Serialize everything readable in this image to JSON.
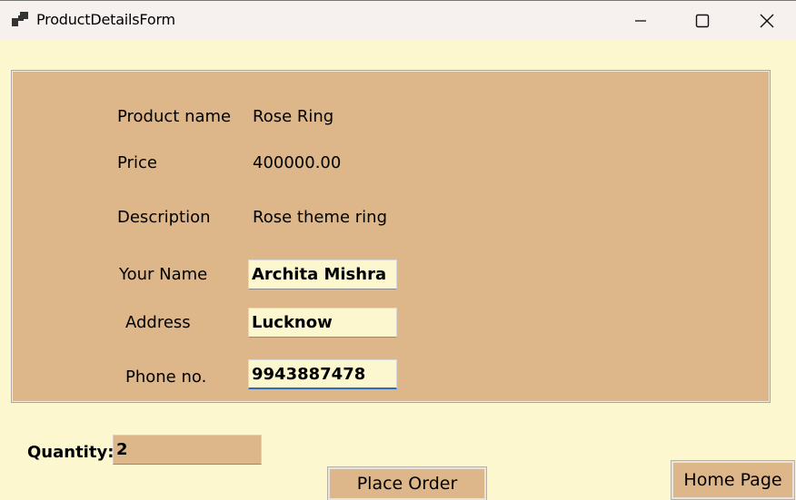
{
  "window": {
    "title": "ProductDetailsForm",
    "controls": {
      "minimize": "minimize-icon",
      "maximize": "maximize-icon",
      "close": "close-icon"
    }
  },
  "details": {
    "product_name_label": "Product name",
    "product_name_value": "Rose Ring",
    "price_label": "Price",
    "price_value": "400000.00",
    "description_label": "Description",
    "description_value": "Rose theme ring",
    "your_name_label": "Your Name",
    "your_name_value": "Archita Mishra",
    "address_label": "Address",
    "address_value": "Lucknow",
    "phone_label": "Phone no.",
    "phone_value": "9943887478"
  },
  "order": {
    "quantity_label": "Quantity:",
    "quantity_value": "2",
    "place_order_label": "Place Order",
    "home_page_label": "Home Page"
  },
  "colors": {
    "background": "#fdf7cf",
    "panel": "#ddb789",
    "titlebar": "#f6f0ef",
    "focus": "#2f6dbb"
  }
}
